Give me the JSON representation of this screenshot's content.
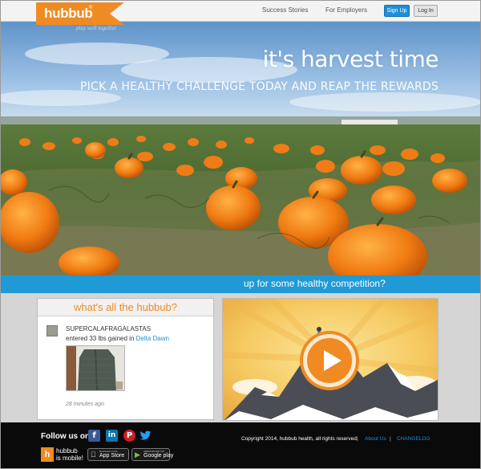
{
  "header": {
    "logo_text": "hubbub",
    "logo_registered": "®",
    "tagline": "play well together",
    "nav": {
      "success_stories": "Success Stories",
      "for_employers": "For Employers",
      "sign_up": "Sign Up",
      "log_in": "Log In"
    }
  },
  "hero": {
    "headline": "it's harvest time",
    "subheadline": "PICK A HEALTHY CHALLENGE TODAY AND REAP THE REWARDS"
  },
  "banner": {
    "text": "up for some healthy competition?"
  },
  "feed": {
    "title": "what's all the hubbub?",
    "item": {
      "username": "SUPERCALAFRAGALASTAS",
      "action_prefix": "entered 33 lbs gained in ",
      "challenge_link": "Delta Dawn",
      "timestamp": "28 minutes ago"
    }
  },
  "video": {
    "icon": "play-icon"
  },
  "footer": {
    "follow_label": "Follow us on:",
    "social": {
      "facebook": "f",
      "linkedin": "in",
      "pinterest": "P",
      "twitter": "🐦"
    },
    "mobile_badge": "h",
    "mobile_line1": "hubbub",
    "mobile_line2": "is mobile!",
    "app_store_small": "Download on the",
    "app_store_big": "App Store",
    "google_small": "ANDROID APP ON",
    "google_big": "Google play",
    "copyright": "Copyright 2014, hubbub health, all rights reserved.",
    "separator": "|",
    "about_us": "About Us",
    "changelog": "CHANGELOG"
  },
  "colors": {
    "brand_orange": "#f08a22",
    "accent_blue": "#1f9ad6",
    "link_blue": "#1e8fd6",
    "footer_bg": "#0a0a0a"
  }
}
